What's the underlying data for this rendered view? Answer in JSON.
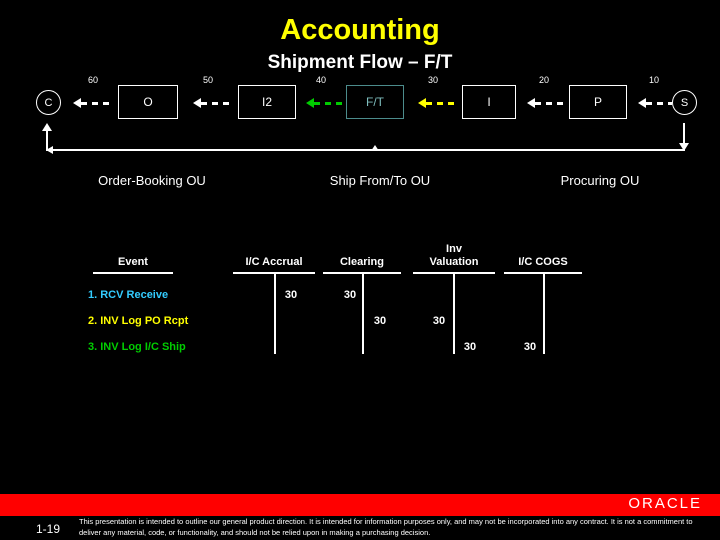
{
  "slide": {
    "title": "Accounting",
    "subtitle": "Shipment Flow – F/T",
    "title_color": "#FFFF00",
    "subtitle_color": "#FFFFFF",
    "background": "#000000"
  },
  "flow": {
    "nodes": [
      {
        "id": "C",
        "label": "C",
        "shape": "circle",
        "color": "#FFFFFF"
      },
      {
        "id": "O",
        "label": "O",
        "shape": "box",
        "color": "#FFFFFF"
      },
      {
        "id": "I2",
        "label": "I2",
        "shape": "box",
        "color": "#FFFFFF"
      },
      {
        "id": "FT",
        "label": "F/T",
        "shape": "box",
        "color": "#7FBFBF"
      },
      {
        "id": "I",
        "label": "I",
        "shape": "box",
        "color": "#FFFFFF"
      },
      {
        "id": "P",
        "label": "P",
        "shape": "box",
        "color": "#FFFFFF"
      },
      {
        "id": "S",
        "label": "S",
        "shape": "circle",
        "color": "#FFFFFF"
      }
    ],
    "arrows": [
      {
        "from": "O",
        "to": "C",
        "label": "60",
        "color": "#FFFFFF"
      },
      {
        "from": "I2",
        "to": "O",
        "label": "50",
        "color": "#FFFFFF"
      },
      {
        "from": "FT",
        "to": "I2",
        "label": "40",
        "color": "#00CC00"
      },
      {
        "from": "I",
        "to": "FT",
        "label": "30",
        "color": "#FFFF00"
      },
      {
        "from": "P",
        "to": "I",
        "label": "20",
        "color": "#FFFFFF"
      },
      {
        "from": "S",
        "to": "P",
        "label": "10",
        "color": "#FFFFFF"
      }
    ]
  },
  "org_units": [
    {
      "label": "Order-Booking OU"
    },
    {
      "label": "Ship From/To OU"
    },
    {
      "label": "Procuring OU"
    }
  ],
  "ledger": {
    "columns": [
      {
        "key": "event",
        "label": "Event"
      },
      {
        "key": "accrual",
        "label": "I/C Accrual"
      },
      {
        "key": "clearing",
        "label": "Clearing"
      },
      {
        "key": "inv_val",
        "label": "Inv\nValuation",
        "label_line1": "Inv",
        "label_line2": "Valuation"
      },
      {
        "key": "ic_cogs",
        "label": "I/C COGS"
      }
    ],
    "rows": [
      {
        "event": "1. RCV Receive",
        "color": "#33CCFF",
        "entries": [
          {
            "column": "accrual",
            "side": "credit",
            "amount": "30"
          },
          {
            "column": "clearing",
            "side": "debit",
            "amount": "30"
          }
        ]
      },
      {
        "event": "2. INV Log PO Rcpt",
        "color": "#FFFF00",
        "entries": [
          {
            "column": "clearing",
            "side": "credit",
            "amount": "30"
          },
          {
            "column": "inv_val",
            "side": "debit",
            "amount": "30"
          }
        ]
      },
      {
        "event": "3. INV Log I/C Ship",
        "color": "#00CC00",
        "entries": [
          {
            "column": "inv_val",
            "side": "credit",
            "amount": "30"
          },
          {
            "column": "ic_cogs",
            "side": "debit",
            "amount": "30"
          }
        ]
      }
    ]
  },
  "footer": {
    "bar_color": "#FF0000",
    "brand": "ORACLE",
    "page_number": "1-19",
    "disclaimer": "This presentation is intended to outline our general product direction.  It is intended for information purposes only, and may not be incorporated into any contract. It is not a commitment to deliver any material, code, or functionality, and should not be relied upon in making a purchasing decision."
  }
}
